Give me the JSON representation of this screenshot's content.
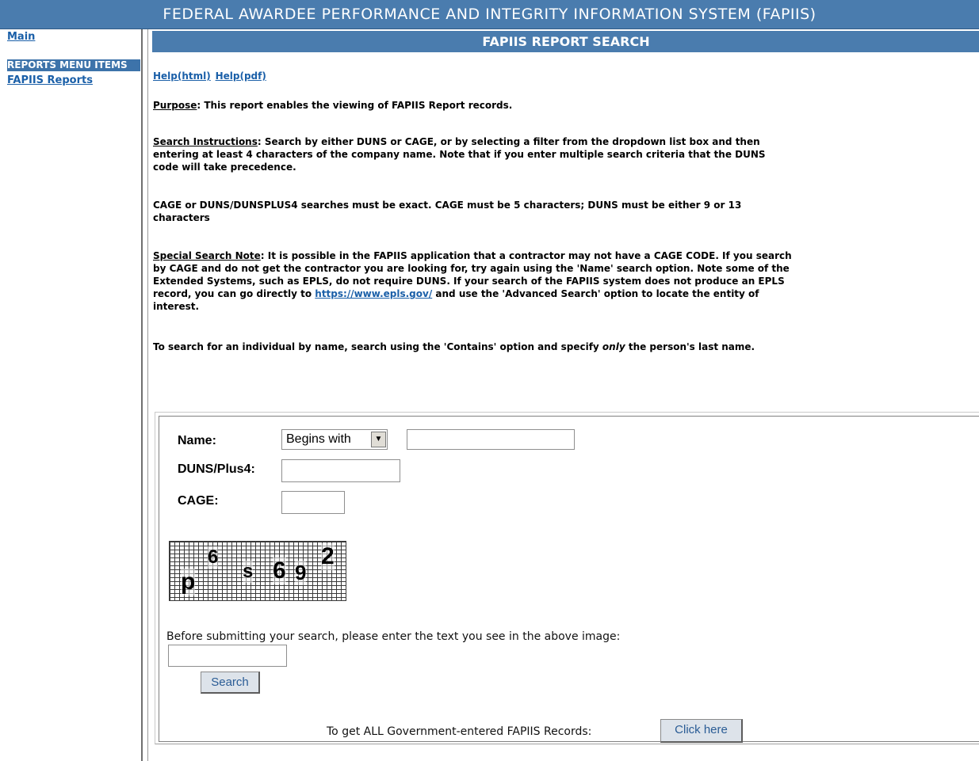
{
  "header": {
    "title": "FEDERAL AWARDEE PERFORMANCE AND INTEGRITY INFORMATION SYSTEM (FAPIIS)"
  },
  "sidebar": {
    "main_link": "Main",
    "menu_heading": "REPORTS MENU ITEMS",
    "reports_link": "FAPIIS Reports"
  },
  "page": {
    "section_title": "FAPIIS REPORT SEARCH",
    "help_html": "Help(html)",
    "help_pdf": "Help(pdf)",
    "purpose_label": "Purpose",
    "purpose_text": ": This report enables the viewing of FAPIIS Report records.",
    "search_instr_label": "Search Instructions",
    "search_instr_text": ": Search by either DUNS or CAGE, or by selecting a filter from the dropdown list box and then entering at least 4 characters of the company name. Note that if you enter multiple search criteria that the DUNS code will take precedence.",
    "exact_text": "CAGE or DUNS/DUNSPLUS4 searches must be exact. CAGE must be 5 characters; DUNS must be either 9 or 13 characters",
    "special_label": "Special Search Note",
    "special_text_1": ": It is possible in the FAPIIS application that a contractor may not have a CAGE CODE. If you search by CAGE and do not get the contractor you are looking for, try again using the 'Name' search option. Note some of the Extended Systems, such as EPLS, do not require DUNS. If your search of the FAPIIS system does not produce an EPLS record, you can go directly to ",
    "special_link": "https://www.epls.gov/",
    "special_text_2": " and use the 'Advanced Search' option to locate the entity of interest.",
    "individual_text_1": "To search for an individual by name, search using the 'Contains' option and specify ",
    "individual_only": "only",
    "individual_text_2": " the person's last name."
  },
  "form": {
    "name_label": "Name:",
    "name_filter": "Begins with",
    "name_value": "",
    "duns_label": "DUNS/Plus4:",
    "duns_value": "",
    "cage_label": "CAGE:",
    "cage_value": "",
    "captcha_chars": [
      "p",
      "6",
      "s",
      "6",
      "9",
      "2"
    ],
    "captcha_instruction": "Before submitting your search, please enter the text you see in the above image:",
    "captcha_value": "",
    "search_button": "Search",
    "all_records_text": "To get ALL Government-entered FAPIIS Records:",
    "click_here_button": "Click here"
  }
}
